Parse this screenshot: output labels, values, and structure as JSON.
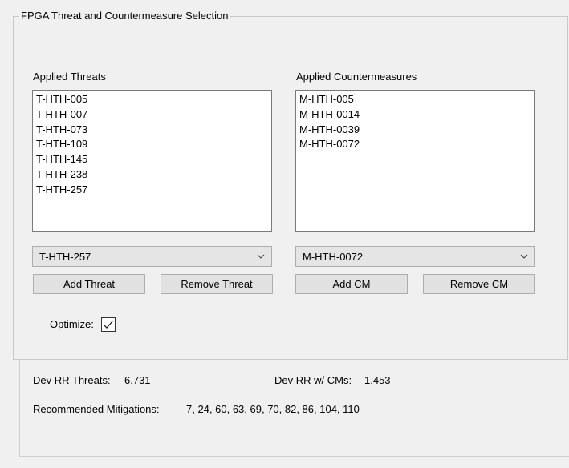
{
  "group": {
    "title": "FPGA Threat and Countermeasure Selection"
  },
  "threats": {
    "label": "Applied Threats",
    "items": [
      "T-HTH-005",
      "T-HTH-007",
      "T-HTH-073",
      "T-HTH-109",
      "T-HTH-145",
      "T-HTH-238",
      "T-HTH-257"
    ],
    "combo_value": "T-HTH-257",
    "add_label": "Add Threat",
    "remove_label": "Remove Threat"
  },
  "countermeasures": {
    "label": "Applied Countermeasures",
    "items": [
      "M-HTH-005",
      "M-HTH-0014",
      "M-HTH-0039",
      "M-HTH-0072"
    ],
    "combo_value": "M-HTH-0072",
    "add_label": "Add CM",
    "remove_label": "Remove CM"
  },
  "optimize": {
    "label": "Optimize:",
    "checked": true
  },
  "results": {
    "dev_rr_threats_label": "Dev  RR Threats:",
    "dev_rr_threats_value": "6.731",
    "dev_rr_cms_label": "Dev  RR w/ CMs:",
    "dev_rr_cms_value": "1.453",
    "recommended_label": "Recommended Mitigations:",
    "recommended_value": "7, 24, 60, 63, 69, 70, 82, 86, 104, 110"
  },
  "icons": {
    "dropdown": "chevron-down-icon",
    "check": "checkmark-icon"
  }
}
